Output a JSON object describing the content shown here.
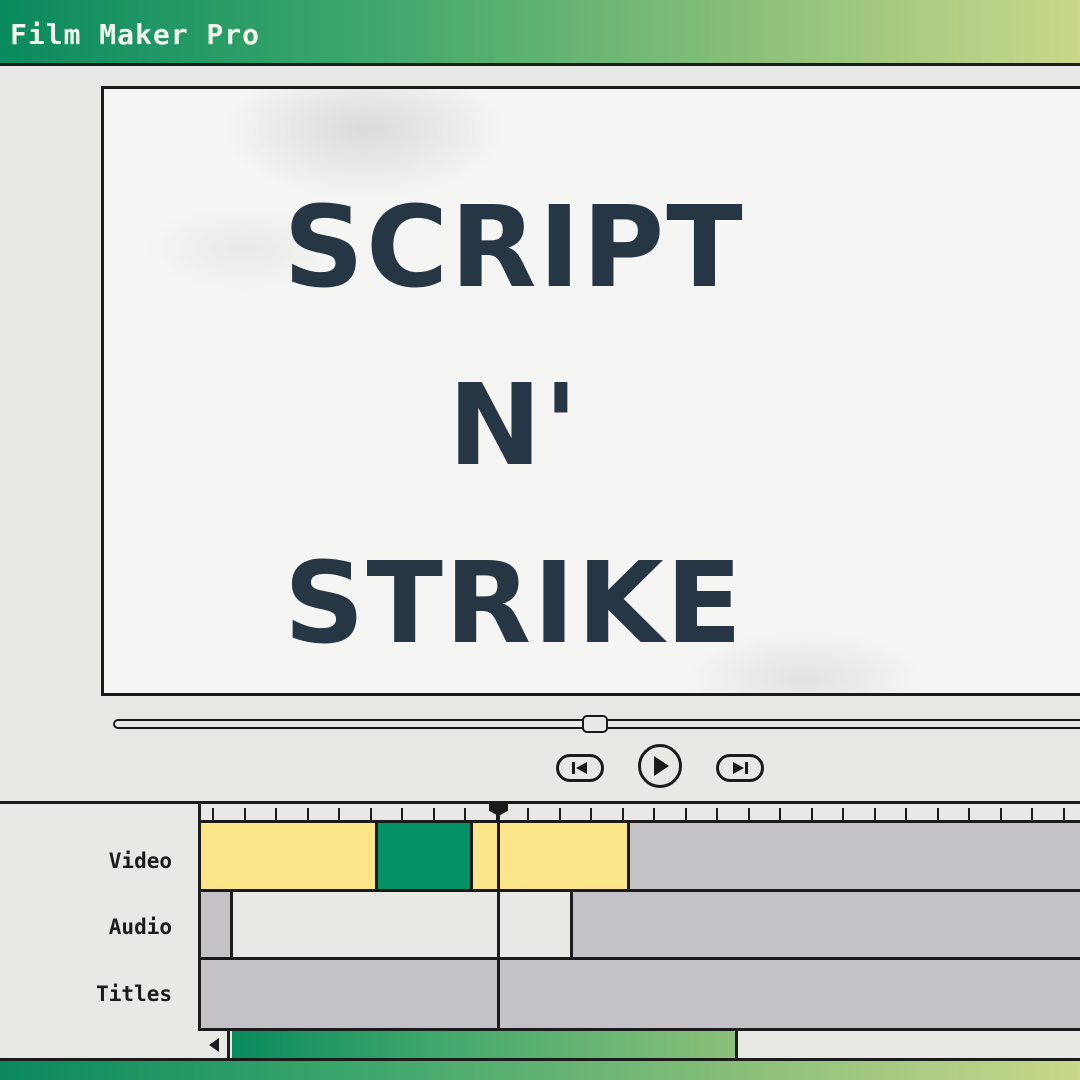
{
  "app": {
    "title": "Film Maker Pro"
  },
  "preview": {
    "lines": [
      "SCRIPT",
      "N'",
      "STRIKE"
    ]
  },
  "playback": {
    "position": 0.49
  },
  "controls": {
    "prev_icon": "skip-back-icon",
    "play_icon": "play-icon",
    "next_icon": "skip-forward-icon"
  },
  "timeline": {
    "tracks": [
      {
        "label": "Video"
      },
      {
        "label": "Audio"
      },
      {
        "label": "Titles"
      }
    ],
    "colors": {
      "yellow": "#fde68a",
      "green": "#039265",
      "gray": "#c4c2c6",
      "light": "#e8e8e4"
    }
  },
  "scroll": {
    "left_icon": "triangle-left-icon"
  }
}
